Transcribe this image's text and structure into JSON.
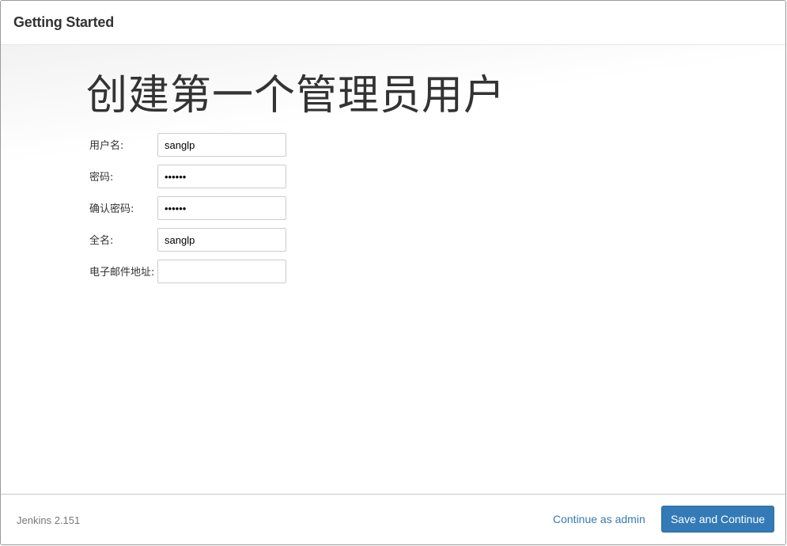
{
  "header": {
    "title": "Getting Started"
  },
  "main": {
    "heading": "创建第一个管理员用户",
    "fields": [
      {
        "label": "用户名:",
        "value": "sanglp",
        "type": "text"
      },
      {
        "label": "密码:",
        "value": "sanglp",
        "type": "password"
      },
      {
        "label": "确认密码:",
        "value": "sanglp",
        "type": "password"
      },
      {
        "label": "全名:",
        "value": "sanglp",
        "type": "text"
      },
      {
        "label": "电子邮件地址:",
        "value": "",
        "type": "text"
      }
    ]
  },
  "footer": {
    "version": "Jenkins 2.151",
    "continue_as_admin": "Continue as admin",
    "save_and_continue": "Save and Continue"
  },
  "colors": {
    "primary": "#337ab7",
    "text": "#333333",
    "muted": "#777777"
  }
}
